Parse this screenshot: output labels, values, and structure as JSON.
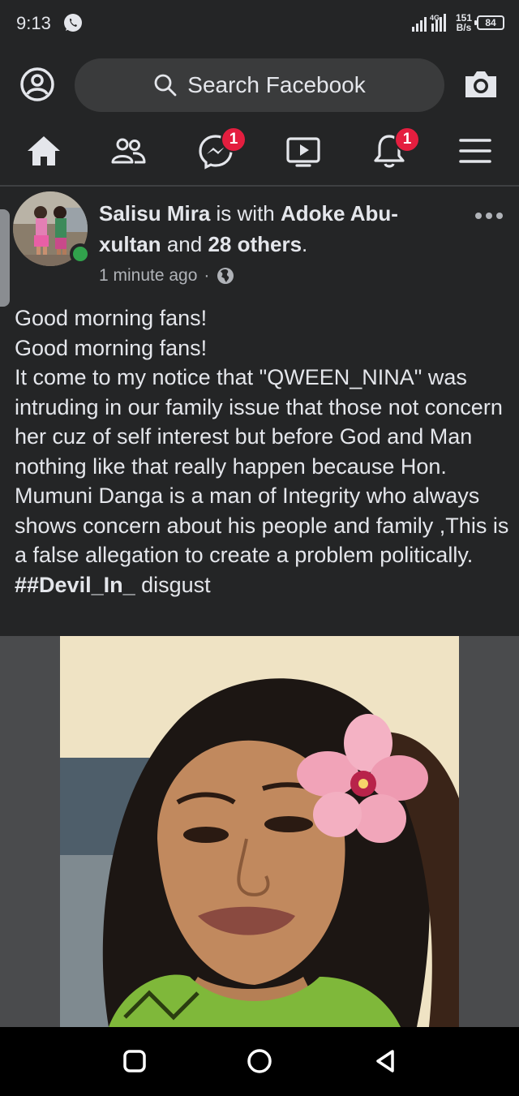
{
  "status_bar": {
    "time": "9:13",
    "network_type": "4G",
    "net_speed_value": "151",
    "net_speed_unit": "B/s",
    "battery": "84"
  },
  "search": {
    "placeholder": "Search Facebook"
  },
  "nav": {
    "messenger_badge": "1",
    "notifications_badge": "1"
  },
  "post": {
    "author": "Salisu Mira",
    "with_word": "is with",
    "tagged": "Adoke Abu-xultan",
    "and_word": "and",
    "others": "28 others",
    "period": ".",
    "timestamp": "1 minute ago",
    "separator": "·",
    "text_lines": [
      "Good morning fans!",
      "Good morning fans!",
      "It come to my notice that \"QWEEN_NINA\" was intruding in our family issue that those not concern her cuz of self interest but before God and Man nothing like that really happen because Hon. Mumuni Danga is a man of Integrity who always shows concern about his people and family ,This is a false allegation to create a problem politically."
    ],
    "hashtag": "##Devil_In_",
    "hashtag_tail": " disgust"
  },
  "colors": {
    "background": "#242526",
    "search_bg": "#3a3b3c",
    "badge": "#e41e3f",
    "online": "#31a24c",
    "text": "#e4e6eb",
    "muted": "#b0b3b8"
  }
}
